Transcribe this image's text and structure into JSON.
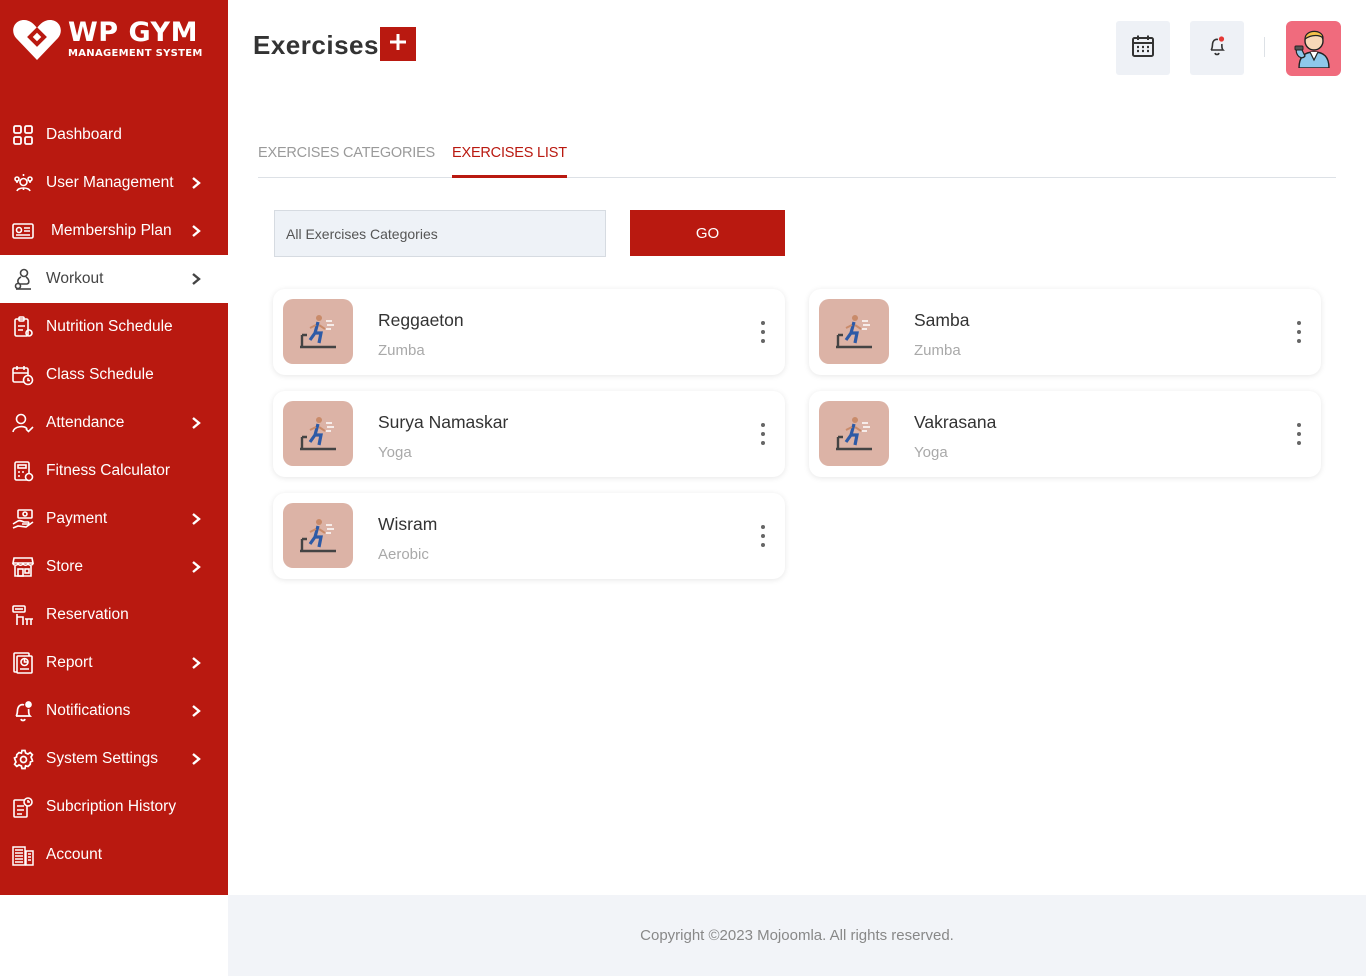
{
  "brand": {
    "title": "WP GYM",
    "subtitle": "MANAGEMENT SYSTEM"
  },
  "sidebar": {
    "items": [
      {
        "label": "Dashboard",
        "icon": "dashboard-grid-icon",
        "chevron": false,
        "active": false
      },
      {
        "label": "User Management",
        "icon": "users-gear-icon",
        "chevron": true,
        "active": false
      },
      {
        "label": "Membership Plan",
        "icon": "membership-card-icon",
        "chevron": true,
        "active": false
      },
      {
        "label": "Workout",
        "icon": "workout-icon",
        "chevron": true,
        "active": true
      },
      {
        "label": "Nutrition Schedule",
        "icon": "nutrition-clipboard-icon",
        "chevron": false,
        "active": false
      },
      {
        "label": "Class Schedule",
        "icon": "calendar-clock-icon",
        "chevron": false,
        "active": false
      },
      {
        "label": "Attendance",
        "icon": "user-check-icon",
        "chevron": true,
        "active": false
      },
      {
        "label": "Fitness Calculator",
        "icon": "calculator-icon",
        "chevron": false,
        "active": false
      },
      {
        "label": "Payment",
        "icon": "payment-hand-icon",
        "chevron": true,
        "active": false
      },
      {
        "label": "Store",
        "icon": "store-icon",
        "chevron": true,
        "active": false
      },
      {
        "label": "Reservation",
        "icon": "reservation-icon",
        "chevron": false,
        "active": false
      },
      {
        "label": "Report",
        "icon": "report-icon",
        "chevron": true,
        "active": false
      },
      {
        "label": "Notifications",
        "icon": "bell-icon",
        "chevron": true,
        "active": false
      },
      {
        "label": "System Settings",
        "icon": "gear-icon",
        "chevron": true,
        "active": false
      },
      {
        "label": "Subcription History",
        "icon": "subscription-history-icon",
        "chevron": false,
        "active": false
      },
      {
        "label": "Account",
        "icon": "account-icon",
        "chevron": false,
        "active": false
      }
    ]
  },
  "header": {
    "title": "Exercises",
    "add_icon": "plus-icon",
    "calendar_icon": "calendar-icon",
    "bell_icon": "bell-icon",
    "avatar_icon": "user-avatar-icon"
  },
  "tabs": [
    {
      "label": "EXERCISES CATEGORIES",
      "active": false
    },
    {
      "label": "EXERCISES LIST",
      "active": true
    }
  ],
  "filter": {
    "selected": "All Exercises Categories",
    "go_label": "GO"
  },
  "exercises": [
    {
      "name": "Reggaeton",
      "category": "Zumba"
    },
    {
      "name": "Samba",
      "category": "Zumba"
    },
    {
      "name": "Surya Namaskar",
      "category": "Yoga"
    },
    {
      "name": "Vakrasana",
      "category": "Yoga"
    },
    {
      "name": "Wisram",
      "category": "Aerobic"
    }
  ],
  "footer": {
    "copyright": "Copyright ©2023 Mojoomla. All rights reserved."
  },
  "colors": {
    "brand_red": "#b91910",
    "thumb_bg": "#dcb3a6",
    "avatar_bg": "#f06b7d",
    "footer_bg": "#f2f4f8",
    "header_btn_bg": "#eef1f6"
  }
}
